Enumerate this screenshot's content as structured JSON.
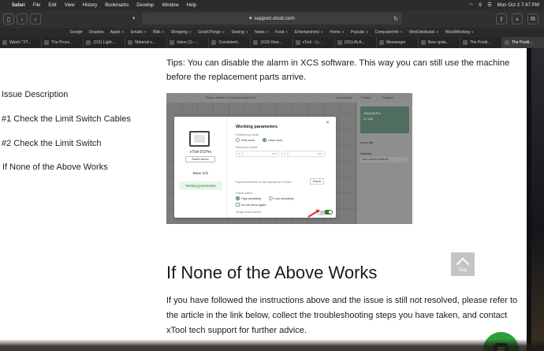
{
  "menubar": {
    "app": "Safari",
    "items": [
      "File",
      "Edit",
      "View",
      "History",
      "Bookmarks",
      "Develop",
      "Window",
      "Help"
    ],
    "clock": "Mon Oct 2  7:47 PM"
  },
  "toolbar": {
    "url": "support.xtool.com"
  },
  "favorites": [
    "Google",
    "Dropbox",
    "Apple",
    "Emails",
    "Bills",
    "Shopping",
    "GreekThings",
    "Sewing",
    "News",
    "Food",
    "Entertainment",
    "Home",
    "Popular",
    "ComputerInfo",
    "WebSiteAssist",
    "WoodWorking"
  ],
  "tabs": [
    {
      "label": "Watch \"XT...",
      "active": false
    },
    {
      "label": "The Proce...",
      "active": false
    },
    {
      "label": "(311) Light...",
      "active": false
    },
    {
      "label": "Material s...",
      "active": false
    },
    {
      "label": "Inbox (1) -...",
      "active": false
    },
    {
      "label": "Consistent...",
      "active": false
    },
    {
      "label": "(310) How...",
      "active": false
    },
    {
      "label": "xTool - Li...",
      "active": false
    },
    {
      "label": "(311) ALA...",
      "active": false
    },
    {
      "label": "Messenger",
      "active": false
    },
    {
      "label": "New upda...",
      "active": false
    },
    {
      "label": "The Positi...",
      "active": false
    },
    {
      "label": "The Positi...",
      "active": true
    }
  ],
  "toc": {
    "items": [
      "Issue Description",
      "#1 Check the Limit Switch Cables",
      "#2 Check the Limit Switch",
      "If None of the Above Works"
    ]
  },
  "article": {
    "tips": "Tips: You can disable the alarm in XCS software. This way you can still use the machine before the replacement parts arrive.",
    "heading": "If None of the Above Works",
    "paragraph": "If you have followed the instructions above and the issue is still not resolved, please refer to the article in the link below, collect the troubleshooting steps you have taken, and contact xTool tech support for further advice."
  },
  "screenshot": {
    "topbar_title": "Phone Holder Front 6mm array 5X1",
    "topbar_nav": [
      "Community",
      "Project",
      "Support"
    ],
    "sidebar_device": "xTool D1Pro",
    "sidebar_sub": "IX 13B",
    "sidebar_laser": "Laser flat",
    "sidebar_material_label": "Material",
    "sidebar_material_value": "User-defined material",
    "device_name": "xTool D1Pro",
    "switch_device": "Switch device",
    "basic_info": "Basic info",
    "working_parameters_tab": "Working parameters",
    "dialog_title": "Working parameters",
    "positioning_mode": "Positioning mode",
    "red_cross": "Red cross",
    "laser_spot": "Laser spot",
    "red_cross_offset": "Red cross offset",
    "offset_x": "X: 0",
    "offset_y": "Y: 0",
    "unit_mm": "mm",
    "export_label": "Export elements on the canvas as GCode",
    "export_button": "Export",
    "flame_alarm": "Flame alarm",
    "high_sensitivity": "High sensitivity",
    "low_sensitivity": "Low sensitivity",
    "do_not_show": "Do not show again",
    "stops_when_moved": "Stops when moved",
    "limit_switch": "Limit switch"
  },
  "widgets": {
    "top_label": "Top"
  },
  "colors": {
    "accent_green": "#2e9d3c",
    "top_button": "#c4c4c4"
  }
}
